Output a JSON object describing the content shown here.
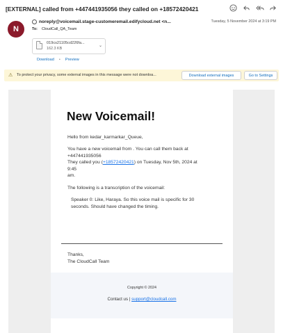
{
  "header": {
    "subject": "[EXTERNAL] called from +447441935056 they called on +18572420421",
    "actions": [
      {
        "name": "smiley-icon",
        "glyph": "☺"
      },
      {
        "name": "reply-icon",
        "glyph": "↶"
      },
      {
        "name": "reply-all-icon",
        "glyph": "↶"
      },
      {
        "name": "forward-icon",
        "glyph": "↷"
      }
    ],
    "avatar_initial": "N",
    "avatar_color": "#8b1a2b",
    "from": "noreply@voicemail.stage-customeremail.edifycloud.net <n...",
    "date": "Tuesday, 5 November 2024 at 3:19 PM",
    "to_label": "To:",
    "to_value": "CloudCall_QA_Team"
  },
  "attachment": {
    "filename": "019cs21105cd226fa...",
    "size": "162.3 KB",
    "download_label": "Download",
    "separator": "•",
    "preview_label": "Preview"
  },
  "infobar": {
    "message": "To protect your privacy, some external images in this message were not downloa...",
    "download_external": "Download external images",
    "go_to_settings": "Go to Settings"
  },
  "email": {
    "title": "New Voicemail!",
    "greeting": "Hello from kedar_karmarkar_Queue,",
    "line1": "You have a new voicemail from . You can call them back at",
    "line2": "+447441935056",
    "line3_pre": "They called you (",
    "line3_link": "+18572420421",
    "line3_post": ") on Tuesday, Nov 5th, 2024 at 9:45",
    "line4": "am.",
    "transcription_header": "The following is a transcription of the voicemail:",
    "transcription": "Speaker 0: Like, Haraya. So this voice mail is specific for 30 seconds. Should have changed the timing.",
    "thanks": "Thanks,",
    "signoff": "The CloudCall Team",
    "copyright": "Copyright © 2024",
    "contact_pre": "Contact us | ",
    "contact_link": "support@cloudcall.com"
  }
}
